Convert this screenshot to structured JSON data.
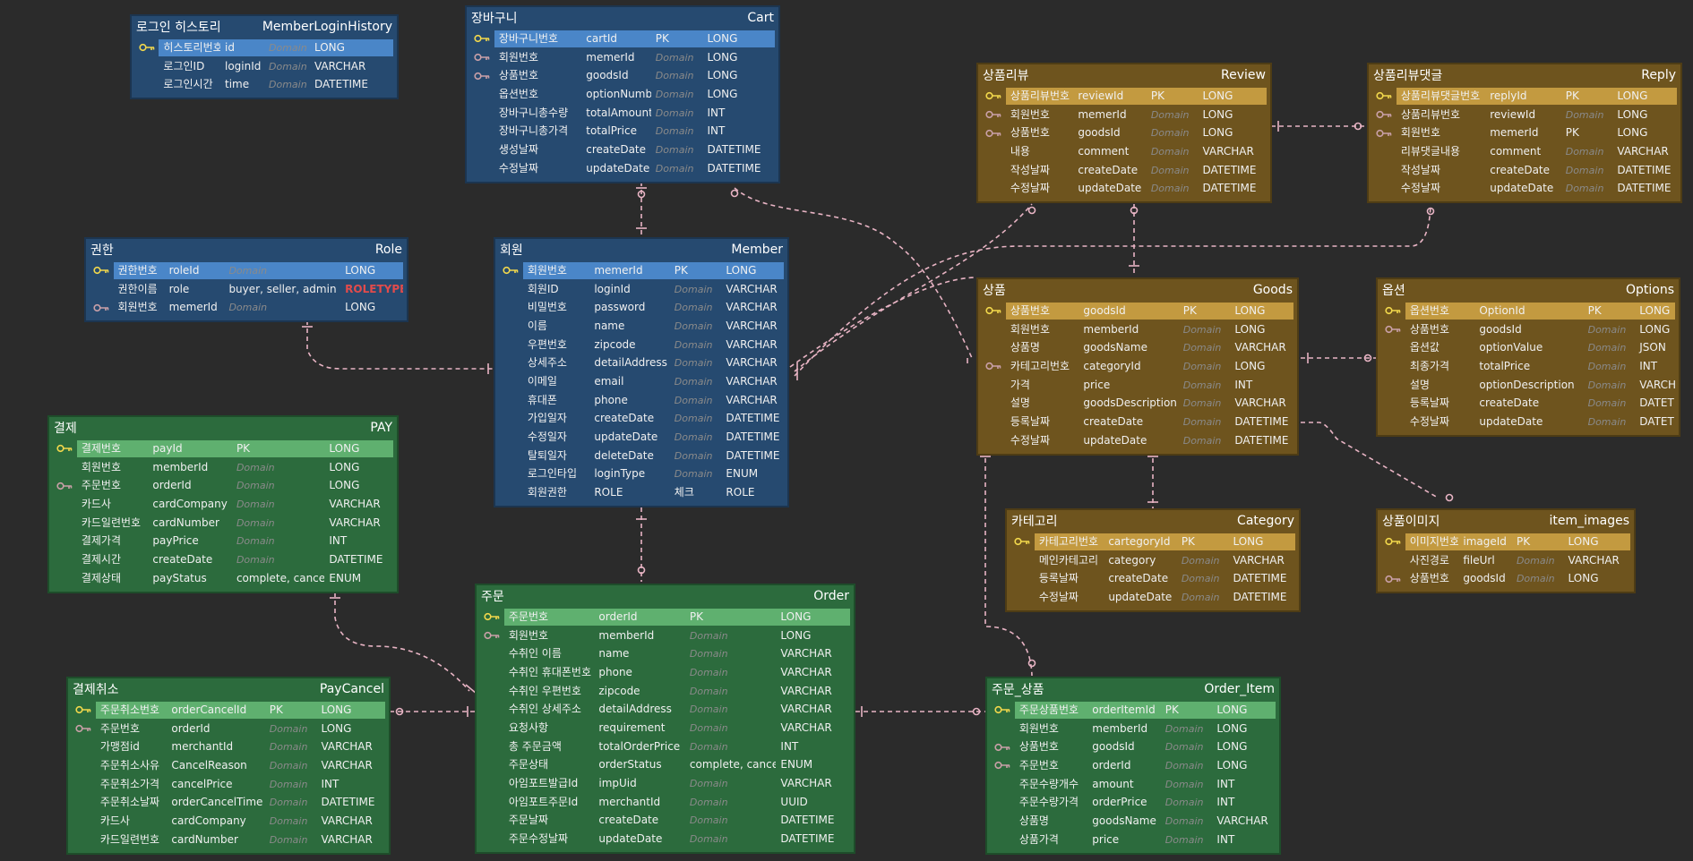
{
  "colors": {
    "blue": "#264a70",
    "green": "#2c6b3d",
    "brown": "#6e541e",
    "relation": "#e8b4c4",
    "pk_key": "#f2d84c",
    "fk_key": "#c9a0a8"
  },
  "entities": [
    {
      "id": "loginhistory",
      "title_kr": "로그인 히스토리",
      "title_en": "MemberLoginHistory",
      "theme": "blue",
      "rows": [
        [
          "pk",
          "히스토리번호",
          "id",
          "Domain",
          "LONG"
        ],
        [
          "",
          "로그인ID",
          "loginId",
          "Domain",
          "VARCHAR"
        ],
        [
          "",
          "로그인시간",
          "time",
          "Domain",
          "DATETIME"
        ]
      ]
    },
    {
      "id": "cart",
      "title_kr": "장바구니",
      "title_en": "Cart",
      "theme": "blue",
      "rows": [
        [
          "pk",
          "장바구니번호",
          "cartId",
          "PK",
          "LONG"
        ],
        [
          "fk",
          "회원번호",
          "memerId",
          "Domain",
          "LONG"
        ],
        [
          "fk",
          "상품번호",
          "goodsId",
          "Domain",
          "LONG"
        ],
        [
          "",
          "옵션번호",
          "optionNumber",
          "Domain",
          "LONG"
        ],
        [
          "",
          "장바구니총수량",
          "totalAmount",
          "Domain",
          "INT"
        ],
        [
          "",
          "장바구니총가격",
          "totalPrice",
          "Domain",
          "INT"
        ],
        [
          "",
          "생성날짜",
          "createDate",
          "Domain",
          "DATETIME"
        ],
        [
          "",
          "수정날짜",
          "updateDate",
          "Domain",
          "DATETIME"
        ]
      ]
    },
    {
      "id": "role",
      "title_kr": "권한",
      "title_en": "Role",
      "theme": "blue",
      "rows": [
        [
          "pk",
          "권한번호",
          "roleId",
          "Domain",
          "LONG"
        ],
        [
          "",
          "권한이름",
          "role",
          "buyer, seller, admin",
          "ROLETYPE"
        ],
        [
          "fk",
          "회원번호",
          "memerId",
          "Domain",
          "LONG"
        ]
      ]
    },
    {
      "id": "member",
      "title_kr": "회원",
      "title_en": "Member",
      "theme": "blue",
      "rows": [
        [
          "pk",
          "회원번호",
          "memerId",
          "PK",
          "LONG"
        ],
        [
          "",
          "회원ID",
          "loginId",
          "Domain",
          "VARCHAR"
        ],
        [
          "",
          "비밀번호",
          "password",
          "Domain",
          "VARCHAR"
        ],
        [
          "",
          "이름",
          "name",
          "Domain",
          "VARCHAR"
        ],
        [
          "",
          "우편번호",
          "zipcode",
          "Domain",
          "VARCHAR"
        ],
        [
          "",
          "상세주소",
          "detailAddress",
          "Domain",
          "VARCHAR"
        ],
        [
          "",
          "이메일",
          "email",
          "Domain",
          "VARCHAR"
        ],
        [
          "",
          "휴대폰",
          "phone",
          "Domain",
          "VARCHAR"
        ],
        [
          "",
          "가입일자",
          "createDate",
          "Domain",
          "DATETIME"
        ],
        [
          "",
          "수정일자",
          "updateDate",
          "Domain",
          "DATETIME"
        ],
        [
          "",
          "탈퇴일자",
          "deleteDate",
          "Domain",
          "DATETIME"
        ],
        [
          "",
          "로그인타입",
          "loginType",
          "Domain",
          "ENUM"
        ],
        [
          "",
          "회원권한",
          "ROLE",
          "체크",
          "ROLE"
        ]
      ]
    },
    {
      "id": "review",
      "title_kr": "상품리뷰",
      "title_en": "Review",
      "theme": "brown",
      "rows": [
        [
          "pk",
          "상품리뷰번호",
          "reviewId",
          "PK",
          "LONG"
        ],
        [
          "fk",
          "회원번호",
          "memerId",
          "Domain",
          "LONG"
        ],
        [
          "fk",
          "상품번호",
          "goodsId",
          "Domain",
          "LONG"
        ],
        [
          "",
          "내용",
          "comment",
          "Domain",
          "VARCHAR"
        ],
        [
          "",
          "작성날짜",
          "createDate",
          "Domain",
          "DATETIME"
        ],
        [
          "",
          "수정날짜",
          "updateDate",
          "Domain",
          "DATETIME"
        ]
      ]
    },
    {
      "id": "reply",
      "title_kr": "상품리뷰댓글",
      "title_en": "Reply",
      "theme": "brown",
      "rows": [
        [
          "pk",
          "상품리뷰댓글번호",
          "replyId",
          "PK",
          "LONG"
        ],
        [
          "fk",
          "상품리뷰번호",
          "reviewId",
          "Domain",
          "LONG"
        ],
        [
          "fk",
          "회원번호",
          "memerId",
          "PK",
          "LONG"
        ],
        [
          "",
          "리뷰댓글내용",
          "comment",
          "Domain",
          "VARCHAR"
        ],
        [
          "",
          "작성날짜",
          "createDate",
          "Domain",
          "DATETIME"
        ],
        [
          "",
          "수정날짜",
          "updateDate",
          "Domain",
          "DATETIME"
        ]
      ]
    },
    {
      "id": "goods",
      "title_kr": "상품",
      "title_en": "Goods",
      "theme": "brown",
      "rows": [
        [
          "pk",
          "상품번호",
          "goodsId",
          "PK",
          "LONG"
        ],
        [
          "",
          "회원번호",
          "memberId",
          "Domain",
          "LONG"
        ],
        [
          "",
          "상품명",
          "goodsName",
          "Domain",
          "VARCHAR"
        ],
        [
          "fk",
          "카테고리번호",
          "categoryId",
          "Domain",
          "LONG"
        ],
        [
          "",
          "가격",
          "price",
          "Domain",
          "INT"
        ],
        [
          "",
          "설명",
          "goodsDescription",
          "Domain",
          "VARCHAR"
        ],
        [
          "",
          "등록날짜",
          "createDate",
          "Domain",
          "DATETIME"
        ],
        [
          "",
          "수정날짜",
          "updateDate",
          "Domain",
          "DATETIME"
        ]
      ]
    },
    {
      "id": "options",
      "title_kr": "옵션",
      "title_en": "Options",
      "theme": "brown",
      "rows": [
        [
          "pk",
          "옵션번호",
          "OptionId",
          "PK",
          "LONG"
        ],
        [
          "fk",
          "상품번호",
          "goodsId",
          "Domain",
          "LONG"
        ],
        [
          "",
          "옵션값",
          "optionValue",
          "Domain",
          "JSON"
        ],
        [
          "",
          "최종가격",
          "totalPrice",
          "Domain",
          "INT"
        ],
        [
          "",
          "설명",
          "optionDescription",
          "Domain",
          "VARCHAR"
        ],
        [
          "",
          "등록날짜",
          "createDate",
          "Domain",
          "DATETIME"
        ],
        [
          "",
          "수정날짜",
          "updateDate",
          "Domain",
          "DATETIME"
        ]
      ]
    },
    {
      "id": "pay",
      "title_kr": "결제",
      "title_en": "PAY",
      "theme": "green",
      "rows": [
        [
          "pk",
          "결제번호",
          "payId",
          "PK",
          "LONG"
        ],
        [
          "",
          "회원번호",
          "memberId",
          "Domain",
          "LONG"
        ],
        [
          "fk",
          "주문번호",
          "orderId",
          "Domain",
          "LONG"
        ],
        [
          "",
          "카드사",
          "cardCompany",
          "Domain",
          "VARCHAR"
        ],
        [
          "",
          "카드일련번호",
          "cardNumber",
          "Domain",
          "VARCHAR"
        ],
        [
          "",
          "결제가격",
          "payPrice",
          "Domain",
          "INT"
        ],
        [
          "",
          "결제시간",
          "createDate",
          "Domain",
          "DATETIME"
        ],
        [
          "",
          "결제상태",
          "payStatus",
          "complete, cancel",
          "ENUM"
        ]
      ]
    },
    {
      "id": "category",
      "title_kr": "카테고리",
      "title_en": "Category",
      "theme": "brown",
      "rows": [
        [
          "pk",
          "카테고리번호",
          "cartegoryId",
          "PK",
          "LONG"
        ],
        [
          "",
          "메인카테고리",
          "category",
          "Domain",
          "VARCHAR"
        ],
        [
          "",
          "등록날짜",
          "createDate",
          "Domain",
          "DATETIME"
        ],
        [
          "",
          "수정날짜",
          "updateDate",
          "Domain",
          "DATETIME"
        ]
      ]
    },
    {
      "id": "itemimages",
      "title_kr": "상품이미지",
      "title_en": "item_images",
      "theme": "brown",
      "rows": [
        [
          "pk",
          "이미지번호",
          "imageId",
          "PK",
          "LONG"
        ],
        [
          "",
          "사진경로",
          "fileUrl",
          "Domain",
          "VARCHAR"
        ],
        [
          "fk",
          "상품번호",
          "goodsId",
          "Domain",
          "LONG"
        ]
      ]
    },
    {
      "id": "order",
      "title_kr": "주문",
      "title_en": "Order",
      "theme": "green",
      "rows": [
        [
          "pk",
          "주문번호",
          "orderId",
          "PK",
          "LONG"
        ],
        [
          "fk",
          "회원번호",
          "memberId",
          "Domain",
          "LONG"
        ],
        [
          "",
          "수취인 이름",
          "name",
          "Domain",
          "VARCHAR"
        ],
        [
          "",
          "수취인 휴대폰번호",
          "phone",
          "Domain",
          "VARCHAR"
        ],
        [
          "",
          "수취인 우편번호",
          "zipcode",
          "Domain",
          "VARCHAR"
        ],
        [
          "",
          "수취인 상세주소",
          "detailAddress",
          "Domain",
          "VARCHAR"
        ],
        [
          "",
          "요청사항",
          "requirement",
          "Domain",
          "VARCHAR"
        ],
        [
          "",
          "총 주문금액",
          "totalOrderPrice",
          "Domain",
          "INT"
        ],
        [
          "",
          "주문상태",
          "orderStatus",
          "complete, cancel",
          "ENUM"
        ],
        [
          "",
          "아임포트발급Id",
          "impUid",
          "Domain",
          "VARCHAR"
        ],
        [
          "",
          "아임포트주문Id",
          "merchantId",
          "Domain",
          "UUID"
        ],
        [
          "",
          "주문날짜",
          "createDate",
          "Domain",
          "DATETIME"
        ],
        [
          "",
          "주문수정날짜",
          "updateDate",
          "Domain",
          "DATETIME"
        ]
      ]
    },
    {
      "id": "paycancel",
      "title_kr": "결제취소",
      "title_en": "PayCancel",
      "theme": "green",
      "rows": [
        [
          "pk",
          "주문취소번호",
          "orderCancelId",
          "PK",
          "LONG"
        ],
        [
          "fk",
          "주문번호",
          "orderId",
          "Domain",
          "LONG"
        ],
        [
          "",
          "가맹점id",
          "merchantId",
          "Domain",
          "VARCHAR"
        ],
        [
          "",
          "주문취소사유",
          "CancelReason",
          "Domain",
          "VARCHAR"
        ],
        [
          "",
          "주문취소가격",
          "cancelPrice",
          "Domain",
          "INT"
        ],
        [
          "",
          "주문취소날짜",
          "orderCancelTime",
          "Domain",
          "DATETIME"
        ],
        [
          "",
          "카드사",
          "cardCompany",
          "Domain",
          "VARCHAR"
        ],
        [
          "",
          "카드일련번호",
          "cardNumber",
          "Domain",
          "VARCHAR"
        ]
      ]
    },
    {
      "id": "orderitem",
      "title_kr": "주문_상품",
      "title_en": "Order_Item",
      "theme": "green",
      "rows": [
        [
          "pk",
          "주문상품번호",
          "orderItemId",
          "PK",
          "LONG"
        ],
        [
          "",
          "회원번호",
          "memberId",
          "Domain",
          "LONG"
        ],
        [
          "fk",
          "상품번호",
          "goodsId",
          "Domain",
          "LONG"
        ],
        [
          "fk",
          "주문번호",
          "orderId",
          "Domain",
          "LONG"
        ],
        [
          "",
          "주문수량개수",
          "amount",
          "Domain",
          "INT"
        ],
        [
          "",
          "주문수량가격",
          "orderPrice",
          "Domain",
          "INT"
        ],
        [
          "",
          "상품명",
          "goodsName",
          "Domain",
          "VARCHAR"
        ],
        [
          "",
          "상품가격",
          "price",
          "Domain",
          "INT"
        ]
      ]
    }
  ]
}
